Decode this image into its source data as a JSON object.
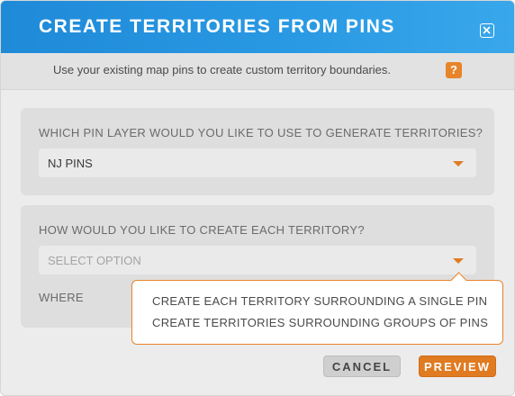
{
  "dialog": {
    "title": "CREATE TERRITORIES FROM PINS",
    "subtitle": "Use your existing map pins to create custom territory boundaries.",
    "help_symbol": "?",
    "icons": {
      "close": "close-icon",
      "help": "help-icon",
      "caret": "chevron-down-icon"
    }
  },
  "pin_layer": {
    "question": "WHICH PIN LAYER WOULD YOU LIKE TO USE TO GENERATE TERRITORIES?",
    "selected": "NJ PINS"
  },
  "territory_method": {
    "question": "HOW WOULD YOU LIKE TO CREATE EACH TERRITORY?",
    "placeholder": "SELECT OPTION",
    "where_label": "WHERE",
    "options": [
      "CREATE EACH TERRITORY SURROUNDING A SINGLE PIN",
      "CREATE TERRITORIES SURROUNDING GROUPS OF PINS"
    ]
  },
  "buttons": {
    "cancel": "CANCEL",
    "preview": "PREVIEW"
  },
  "colors": {
    "header_blue": "#1f8ad8",
    "accent_orange": "#e07b22"
  }
}
